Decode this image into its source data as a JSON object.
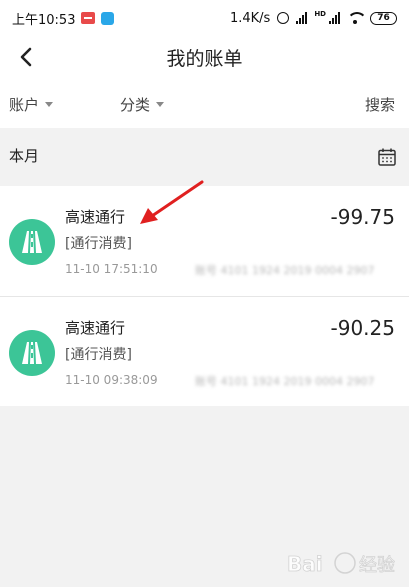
{
  "status_bar": {
    "time": "上午10:53",
    "network_speed": "1.4K/s",
    "signal_label": "HD",
    "battery": "76",
    "icons": [
      "app-badge-icon",
      "app-icon",
      "alarm-icon",
      "signal-icon",
      "wifi-icon",
      "battery-icon"
    ]
  },
  "nav": {
    "title": "我的账单",
    "back_icon": "back-chevron-icon"
  },
  "filters": {
    "account_label": "账户",
    "category_label": "分类",
    "search_label": "搜索"
  },
  "month": {
    "label": "本月",
    "calendar_icon": "calendar-icon"
  },
  "bills": [
    {
      "title": "高速通行",
      "category": "[通行消费]",
      "time": "11-10 17:51:10",
      "card_masked": "账号 4101 1924 2019 0004 2907",
      "amount": "-99.75",
      "icon": "highway-icon"
    },
    {
      "title": "高速通行",
      "category": "[通行消费]",
      "time": "11-10 09:38:09",
      "card_masked": "账号 4101 1924 2019 0004 2907",
      "amount": "-90.25",
      "icon": "highway-icon"
    }
  ],
  "colors": {
    "accent_green": "#3cc597",
    "annotation_red": "#e02020",
    "background": "#f2f2f2"
  },
  "watermark_text": "Bai经验"
}
